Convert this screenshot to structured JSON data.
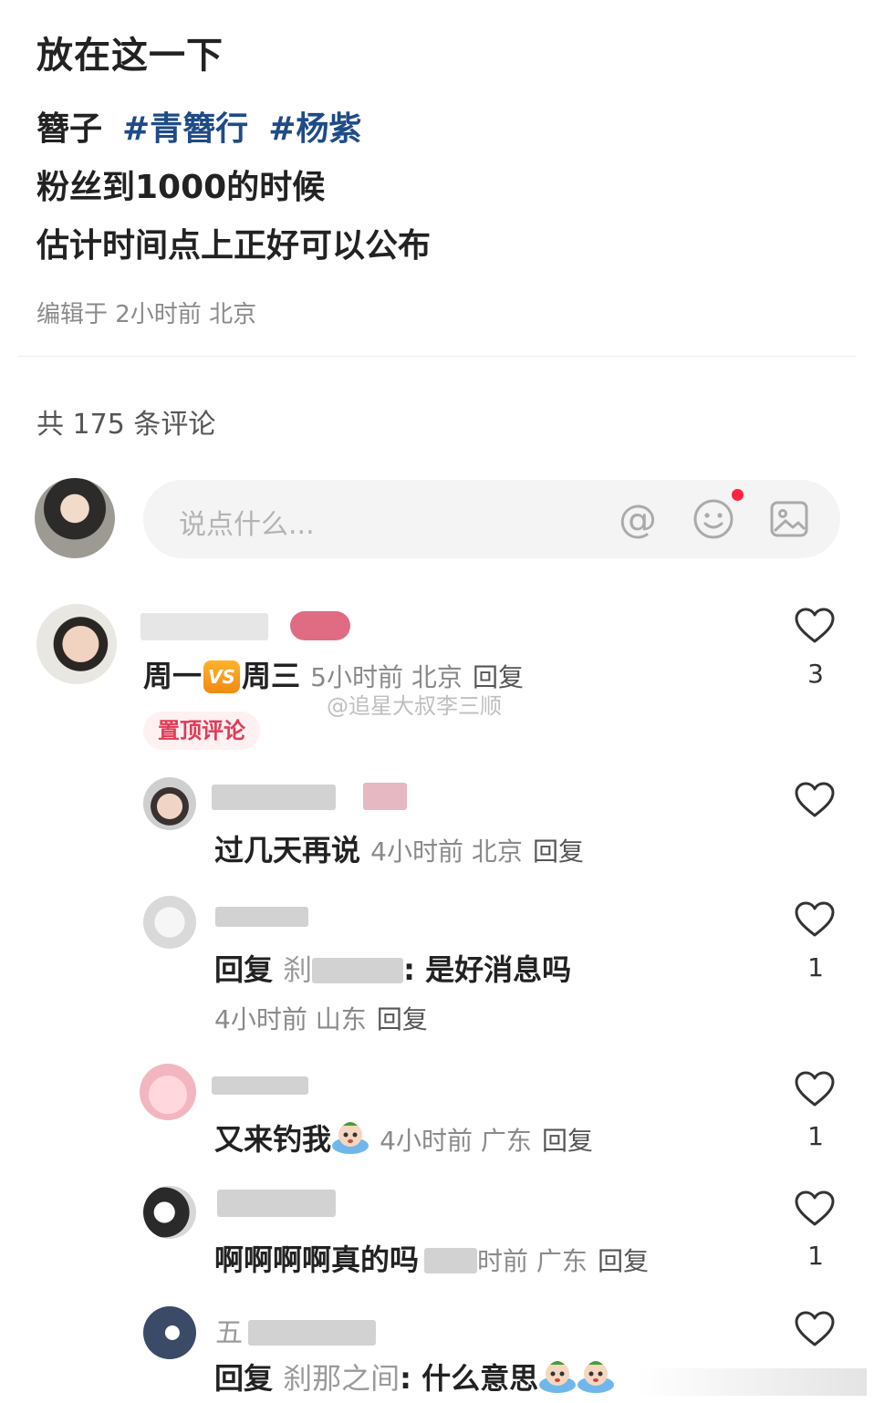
{
  "post": {
    "title": "放在这一下",
    "tags_prefix": "簪子",
    "tags": [
      "#青簪行",
      "#杨紫"
    ],
    "lines": [
      "粉丝到1000的时候",
      "估计时间点上正好可以公布"
    ],
    "edit_meta": "编辑于 2小时前 北京"
  },
  "comments_header": {
    "count_text": "共 175 条评论"
  },
  "input": {
    "placeholder": "说点什么...",
    "at_icon": "at-icon",
    "emoji_icon": "emoji-icon",
    "image_icon": "image-icon"
  },
  "watermark": "@追星大叔李三顺",
  "comments": [
    {
      "text_a": "周一",
      "badge": "VS",
      "text_b": "周三",
      "meta": "5小时前 北京",
      "reply_label": "回复",
      "pinned_label": "置顶评论",
      "likes": "3"
    },
    {
      "text": "过几天再说",
      "meta": "4小时前 北京",
      "reply_label": "回复",
      "likes": ""
    },
    {
      "prefix": "回复",
      "target_fragment": "刹",
      "text": ": 是好消息吗",
      "meta": "4小时前 山东",
      "reply_label": "回复",
      "likes": "1"
    },
    {
      "text": "又来钓我",
      "meta": "4小时前 广东",
      "reply_label": "回复",
      "likes": "1"
    },
    {
      "author_fragment": "",
      "text": "啊啊啊啊真的吗",
      "meta": "时前 广东",
      "reply_label": "回复",
      "likes": "1"
    },
    {
      "author_fragment": "五",
      "prefix": "回复",
      "target": "刹那之间",
      "text": ": 什么意思",
      "likes": ""
    }
  ],
  "colors": {
    "hashtag": "#1f4b87",
    "pinned": "#e03b55",
    "dot": "#ff2442"
  }
}
